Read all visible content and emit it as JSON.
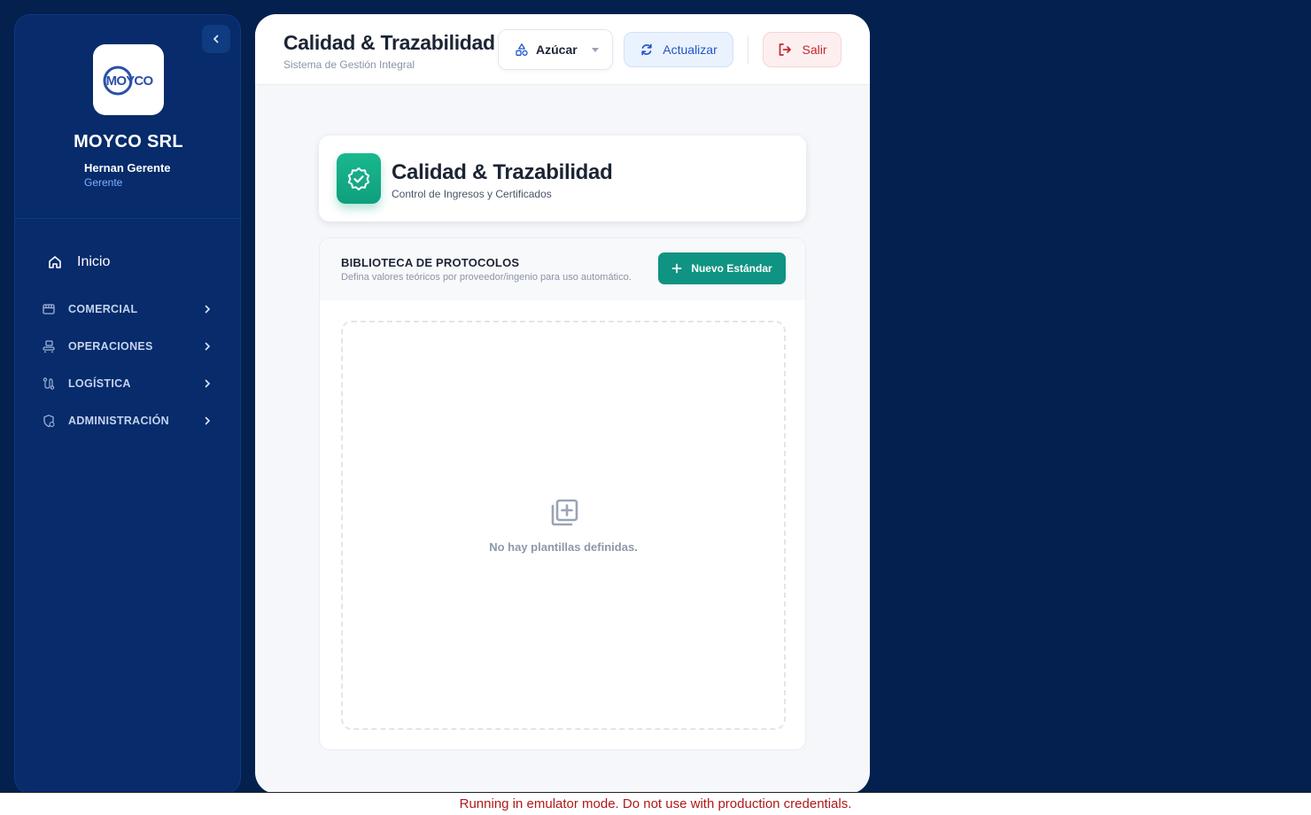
{
  "sidebar": {
    "logo_text": "MOYCO",
    "company": "MOYCO SRL",
    "user": {
      "name": "Hernan Gerente",
      "role": "Gerente"
    },
    "home_label": "Inicio",
    "items": [
      {
        "label": "COMERCIAL",
        "icon": "store-icon"
      },
      {
        "label": "OPERACIONES",
        "icon": "conveyor-icon"
      },
      {
        "label": "LOGÍSTICA",
        "icon": "route-icon"
      },
      {
        "label": "ADMINISTRACIÓN",
        "icon": "shield-gear-icon"
      }
    ]
  },
  "header": {
    "title": "Calidad & Trazabilidad",
    "subtitle": "Sistema de Gestión Integral",
    "product_selected": "Azúcar",
    "refresh_label": "Actualizar",
    "logout_label": "Salir"
  },
  "module": {
    "title": "Calidad & Trazabilidad",
    "subtitle": "Control de Ingresos y Certificados"
  },
  "library": {
    "title": "BIBLIOTECA DE PROTOCOLOS",
    "subtitle": "Defina valores teóricos por proveedor/ingenio para uso automático.",
    "new_button": "Nuevo Estándar",
    "empty_text": "No hay plantillas definidas."
  },
  "emulator_notice": "Running in emulator mode. Do not use with production credentials.",
  "colors": {
    "background": "#03204f",
    "sidebar": "#072b6b",
    "accent_teal": "#0f9382",
    "refresh_blue": "#2156c5",
    "logout_red": "#c2272d"
  }
}
